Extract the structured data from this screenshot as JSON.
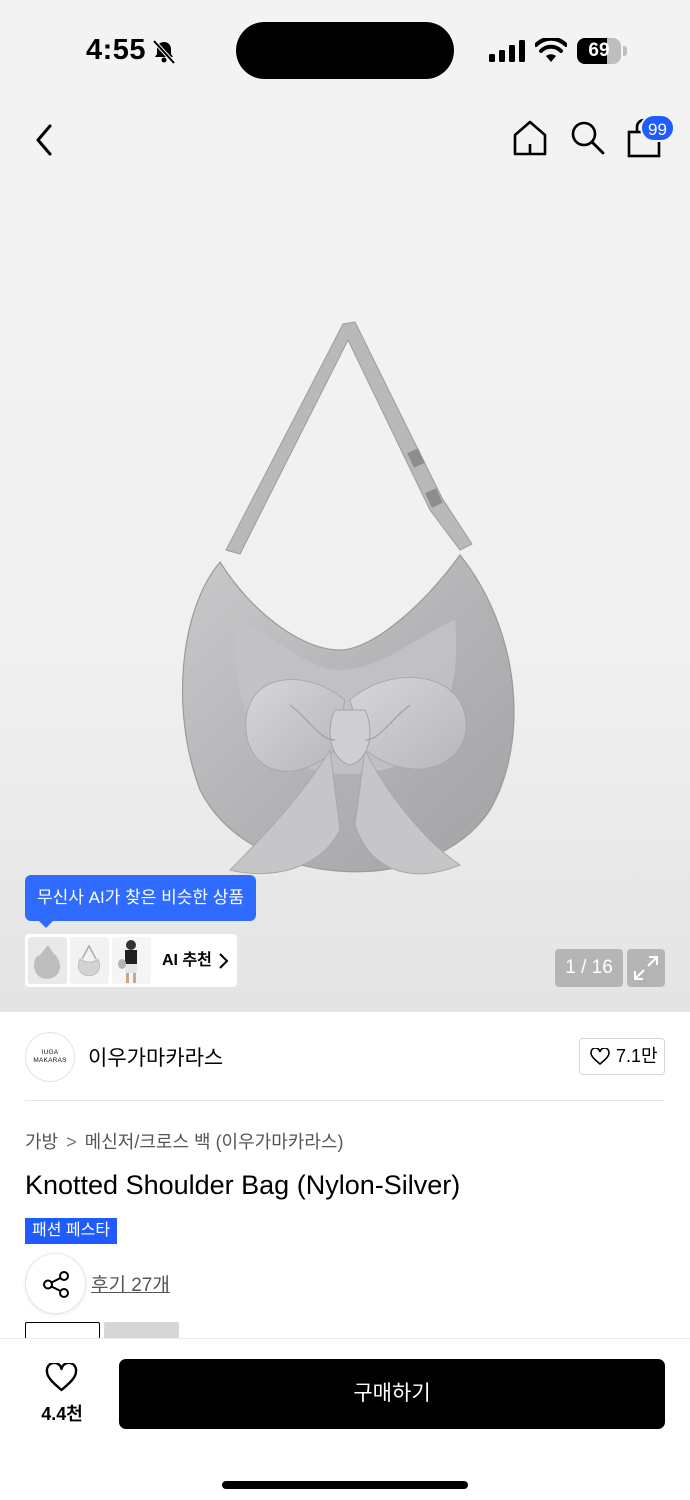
{
  "status_bar": {
    "time": "4:55",
    "battery": "69",
    "battery_level": 0.69
  },
  "nav": {
    "cart_badge": "99",
    "icons": [
      "back-icon",
      "home-icon",
      "search-icon",
      "cart-icon"
    ]
  },
  "gallery": {
    "ai_tooltip": "무신사 AI가 찾은 비슷한 상품",
    "ai_label": "AI 추천",
    "counter": "1 / 16"
  },
  "brand": {
    "logo_line1": "IUGA",
    "logo_line2": "MAKARAS",
    "name": "이우가마카라스",
    "likes": "7.1만"
  },
  "product": {
    "breadcrumb": [
      "가방",
      "메신저/크로스 백 (이우가마카라스)"
    ],
    "title": "Knotted Shoulder Bag (Nylon-Silver)",
    "promo_badge": "패션 페스타",
    "reviews": "후기 27개"
  },
  "bottom": {
    "wish_count": "4.4천",
    "buy_label": "구매하기"
  },
  "colors": {
    "accent": "#1f5cff",
    "tooltip": "#2f6bff",
    "buy_button": "#000000"
  }
}
